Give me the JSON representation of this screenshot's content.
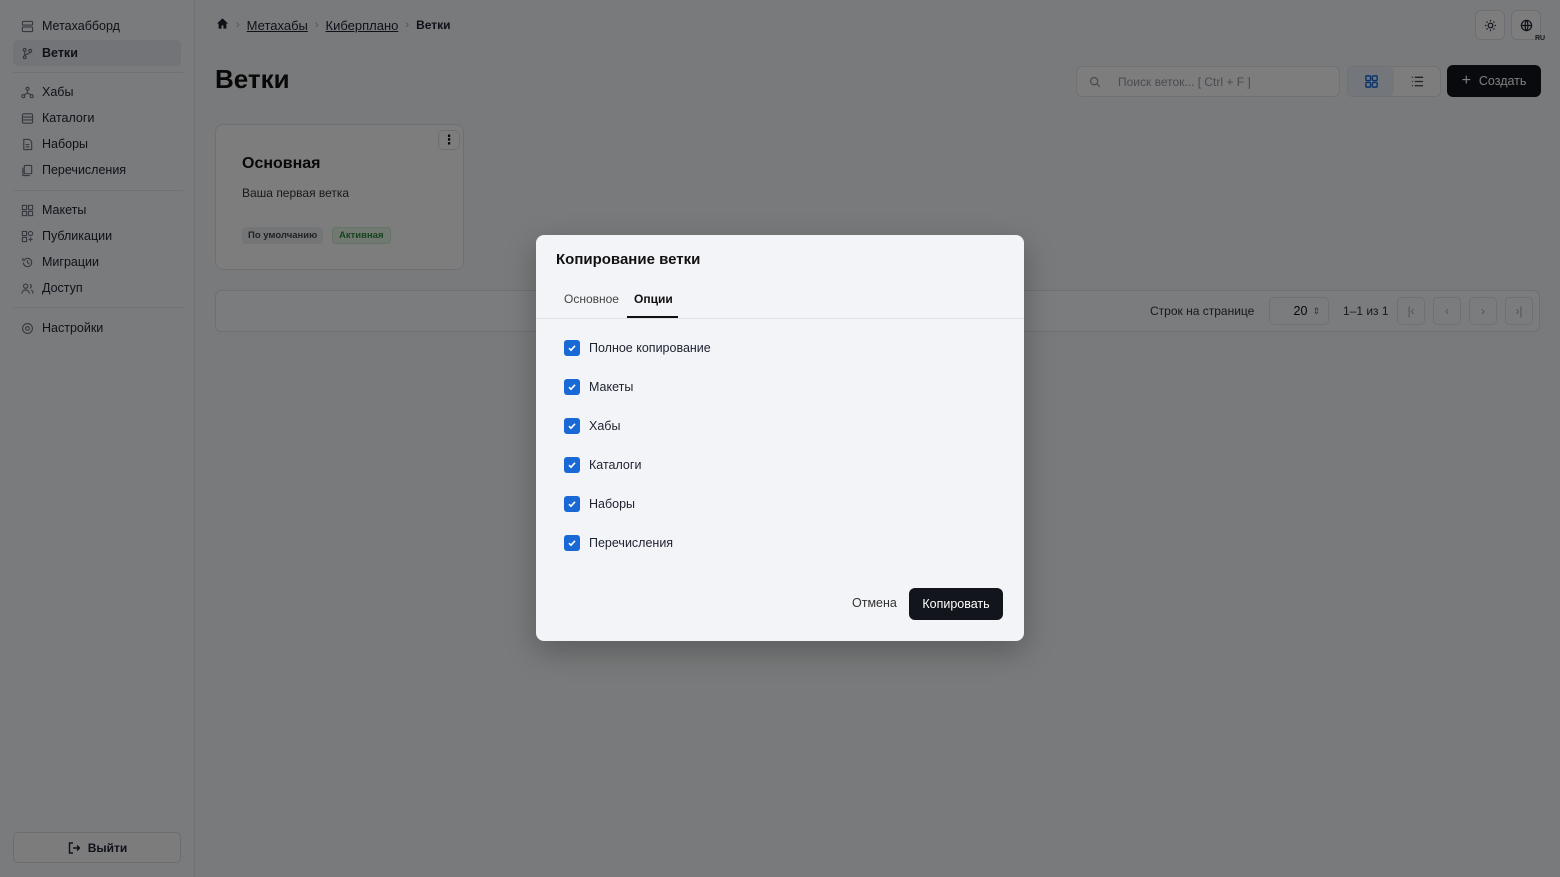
{
  "sidebar": {
    "items": [
      {
        "label": "Метахабборд",
        "icon": "dashboard-icon"
      },
      {
        "label": "Ветки",
        "icon": "branch-icon",
        "active": true
      },
      {
        "label": "Хабы",
        "icon": "hub-icon"
      },
      {
        "label": "Каталоги",
        "icon": "catalog-icon"
      },
      {
        "label": "Наборы",
        "icon": "set-icon"
      },
      {
        "label": "Перечисления",
        "icon": "enum-icon"
      },
      {
        "label": "Макеты",
        "icon": "layout-icon"
      },
      {
        "label": "Публикации",
        "icon": "publication-icon"
      },
      {
        "label": "Миграции",
        "icon": "migration-icon"
      },
      {
        "label": "Доступ",
        "icon": "access-icon"
      },
      {
        "label": "Настройки",
        "icon": "settings-icon"
      }
    ],
    "logout_label": "Выйти"
  },
  "breadcrumb": {
    "items": [
      "Метахабы",
      "Киберплано"
    ],
    "current": "Ветки"
  },
  "header": {
    "lang_badge": "RU",
    "title": "Ветки",
    "search_placeholder": "Поиск веток... [ Ctrl + F ]",
    "create_label": "Создать"
  },
  "card": {
    "title": "Основная",
    "description": "Ваша первая ветка",
    "badge_default": "По умолчанию",
    "badge_active": "Активная"
  },
  "pagination": {
    "rows_label": "Строк на странице",
    "rows_value": "20",
    "range": "1–1 из 1"
  },
  "modal": {
    "title": "Копирование ветки",
    "tabs": [
      "Основное",
      "Опции"
    ],
    "active_tab": "Опции",
    "options": [
      {
        "label": "Полное копирование",
        "checked": true
      },
      {
        "label": "Макеты",
        "checked": true
      },
      {
        "label": "Хабы",
        "checked": true
      },
      {
        "label": "Каталоги",
        "checked": true
      },
      {
        "label": "Наборы",
        "checked": true
      },
      {
        "label": "Перечисления",
        "checked": true
      }
    ],
    "cancel_label": "Отмена",
    "submit_label": "Копировать"
  },
  "colors": {
    "accent": "#1869d6",
    "primary_button": "#12151c",
    "active_badge": "#2b8a3e"
  }
}
